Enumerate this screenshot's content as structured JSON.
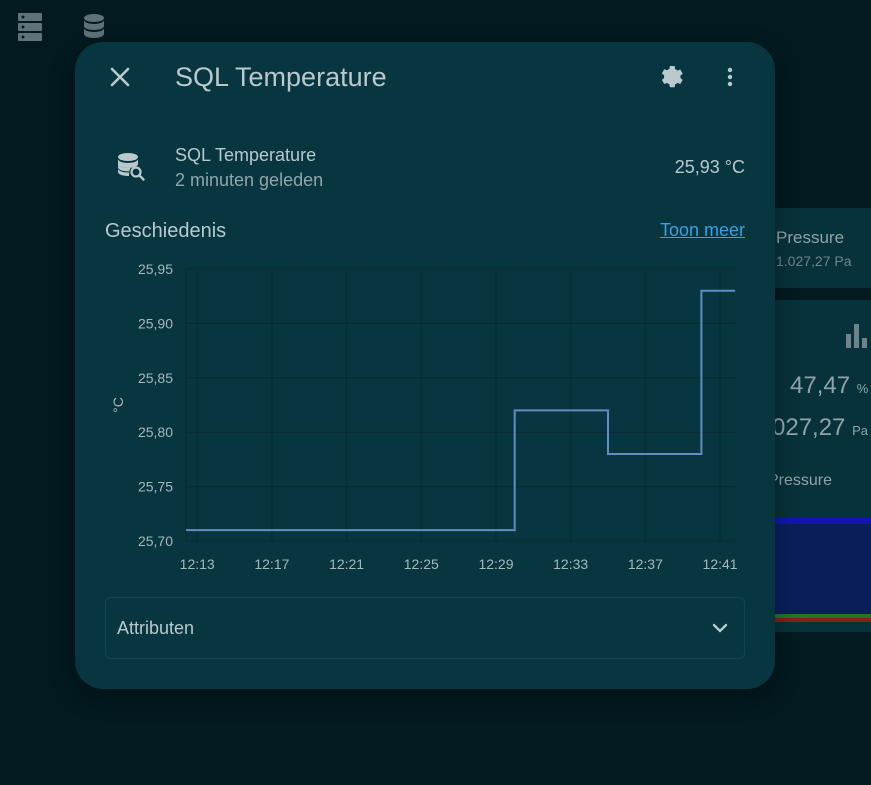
{
  "background": {
    "pressure_card": {
      "label": "Pressure",
      "value": "1.027,27 Pa"
    },
    "sensor_card": {
      "humidity_value": "47,47",
      "humidity_unit": "%",
      "pressure_value": "027,27",
      "pressure_unit": "Pa",
      "label": "Pressure"
    }
  },
  "dialog": {
    "title": "SQL Temperature",
    "entity": {
      "name": "SQL Temperature",
      "last_changed": "2 minuten geleden",
      "state": "25,93 °C"
    },
    "history": {
      "title": "Geschiedenis",
      "show_more": "Toon meer"
    },
    "attributes_label": "Attributen"
  },
  "colors": {
    "accent": "#3b9fe6",
    "line": "#5e8fbf",
    "dialog_bg": "#073540"
  },
  "chart_data": {
    "type": "line",
    "step": true,
    "xlabel": "",
    "ylabel": "°C",
    "x_tick_labels": [
      "12:13",
      "12:17",
      "12:21",
      "12:25",
      "12:29",
      "12:33",
      "12:37",
      "12:41"
    ],
    "x_ticks_min": [
      733,
      737,
      741,
      745,
      749,
      753,
      757,
      761
    ],
    "y_tick_labels": [
      "25,95",
      "25,90",
      "25,85",
      "25,80",
      "25,75",
      "25,70"
    ],
    "y_ticks": [
      25.95,
      25.9,
      25.85,
      25.8,
      25.75,
      25.7
    ],
    "xlim_min": [
      732.4,
      761.8
    ],
    "ylim": [
      25.7,
      25.95
    ],
    "grid": true,
    "series": [
      {
        "x_min": [
          732.4,
          750.0,
          750.0,
          755.0,
          755.0,
          760.0,
          760.0,
          761.8
        ],
        "y": [
          25.71,
          25.71,
          25.82,
          25.82,
          25.78,
          25.78,
          25.93,
          25.93
        ]
      }
    ]
  }
}
